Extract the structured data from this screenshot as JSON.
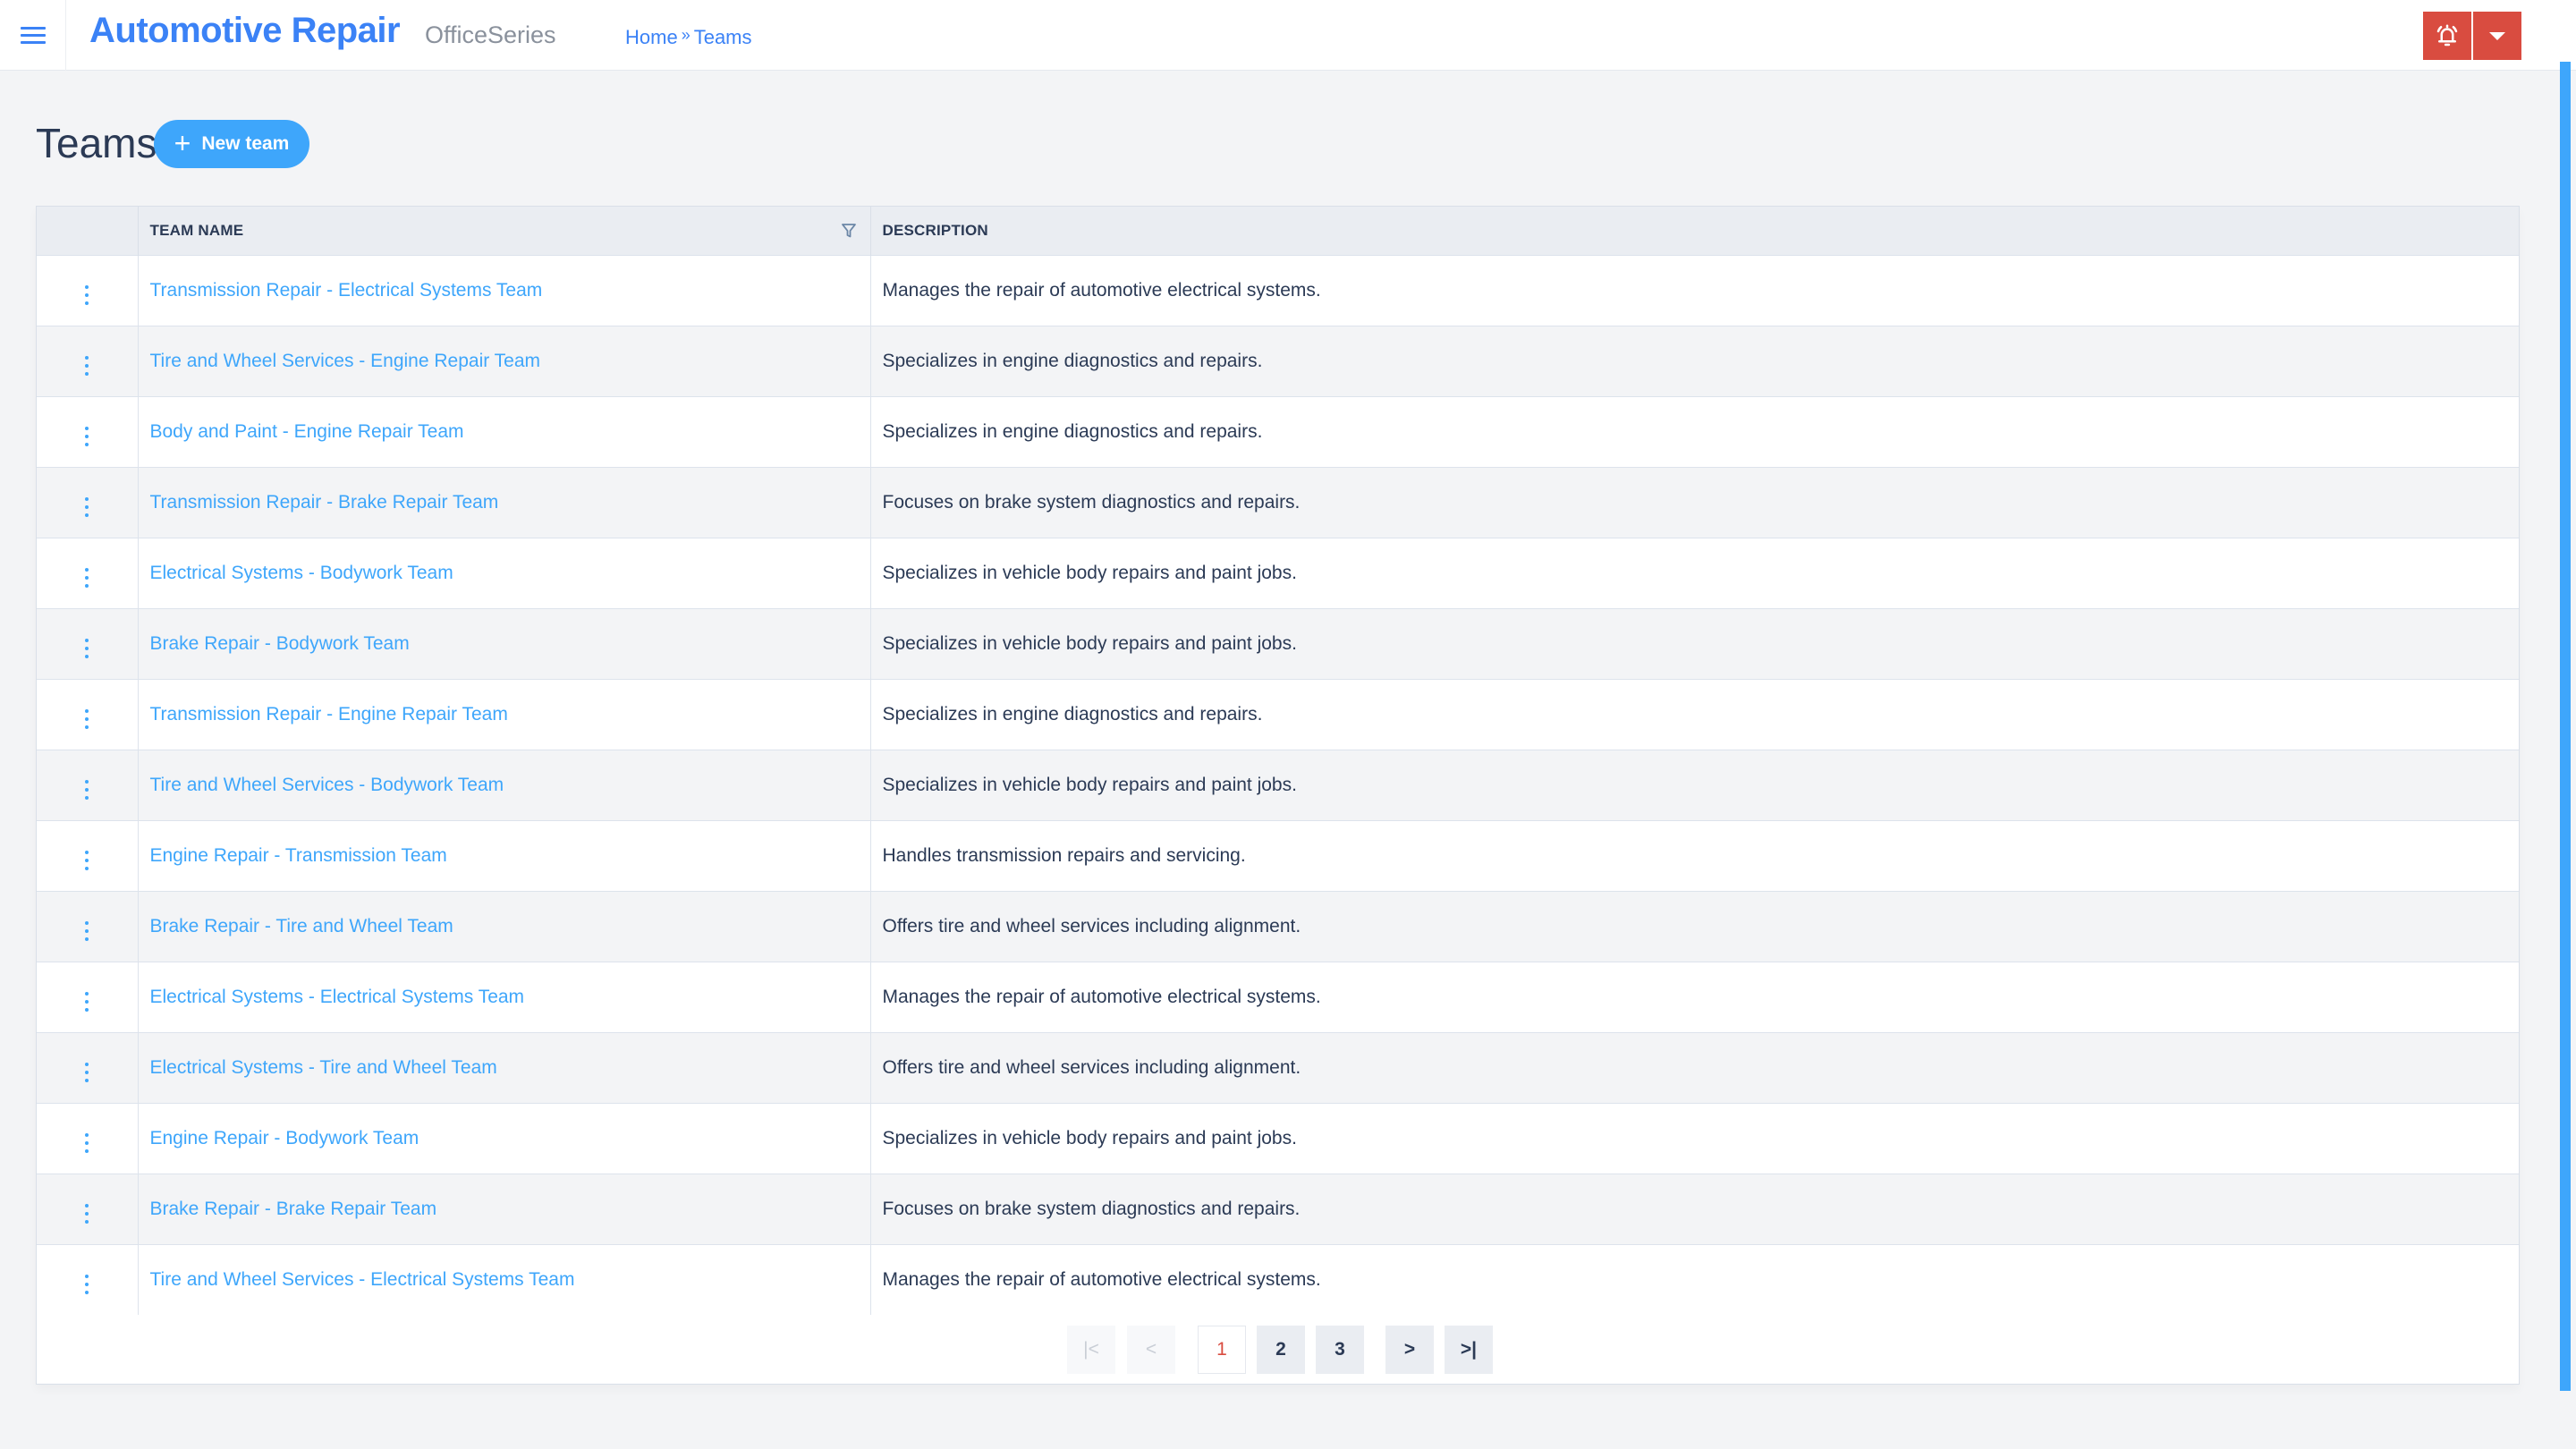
{
  "header": {
    "app_title": "Automotive Repair",
    "app_subtitle": "OfficeSeries",
    "breadcrumb": [
      {
        "label": "Home"
      },
      {
        "label": "Teams"
      }
    ],
    "breadcrumb_separator": "»",
    "menu_icon": "hamburger-icon",
    "notification_icon": "bell-ringing-icon",
    "dropdown_icon": "caret-down-icon"
  },
  "page": {
    "title": "Teams",
    "new_button_label": "New team",
    "new_button_icon": "plus-icon"
  },
  "table": {
    "columns": [
      {
        "key": "actions",
        "label": ""
      },
      {
        "key": "team_name",
        "label": "TEAM NAME",
        "filter_icon": "filter-icon"
      },
      {
        "key": "description",
        "label": "DESCRIPTION"
      }
    ],
    "row_action_icon": "kebab-menu-icon",
    "rows": [
      {
        "team_name": "Transmission Repair - Electrical Systems Team",
        "description": "Manages the repair of automotive electrical systems."
      },
      {
        "team_name": "Tire and Wheel Services - Engine Repair Team",
        "description": "Specializes in engine diagnostics and repairs."
      },
      {
        "team_name": "Body and Paint - Engine Repair Team",
        "description": "Specializes in engine diagnostics and repairs."
      },
      {
        "team_name": "Transmission Repair - Brake Repair Team",
        "description": "Focuses on brake system diagnostics and repairs."
      },
      {
        "team_name": "Electrical Systems - Bodywork Team",
        "description": "Specializes in vehicle body repairs and paint jobs."
      },
      {
        "team_name": "Brake Repair - Bodywork Team",
        "description": "Specializes in vehicle body repairs and paint jobs."
      },
      {
        "team_name": "Transmission Repair - Engine Repair Team",
        "description": "Specializes in engine diagnostics and repairs."
      },
      {
        "team_name": "Tire and Wheel Services - Bodywork Team",
        "description": "Specializes in vehicle body repairs and paint jobs."
      },
      {
        "team_name": "Engine Repair - Transmission Team",
        "description": "Handles transmission repairs and servicing."
      },
      {
        "team_name": "Brake Repair - Tire and Wheel Team",
        "description": "Offers tire and wheel services including alignment."
      },
      {
        "team_name": "Electrical Systems - Electrical Systems Team",
        "description": "Manages the repair of automotive electrical systems."
      },
      {
        "team_name": "Electrical Systems - Tire and Wheel Team",
        "description": "Offers tire and wheel services including alignment."
      },
      {
        "team_name": "Engine Repair - Bodywork Team",
        "description": "Specializes in vehicle body repairs and paint jobs."
      },
      {
        "team_name": "Brake Repair - Brake Repair Team",
        "description": "Focuses on brake system diagnostics and repairs."
      },
      {
        "team_name": "Tire and Wheel Services - Electrical Systems Team",
        "description": "Manages the repair of automotive electrical systems."
      }
    ]
  },
  "pagination": {
    "first": "|<",
    "prev": "<",
    "pages": [
      "1",
      "2",
      "3"
    ],
    "current_page": "1",
    "next": ">",
    "last": ">|"
  },
  "colors": {
    "brand": "#3b82f6",
    "accent": "#3ea6fb",
    "danger": "#d94c40",
    "text": "#2b3a55",
    "background": "#f3f4f6"
  }
}
